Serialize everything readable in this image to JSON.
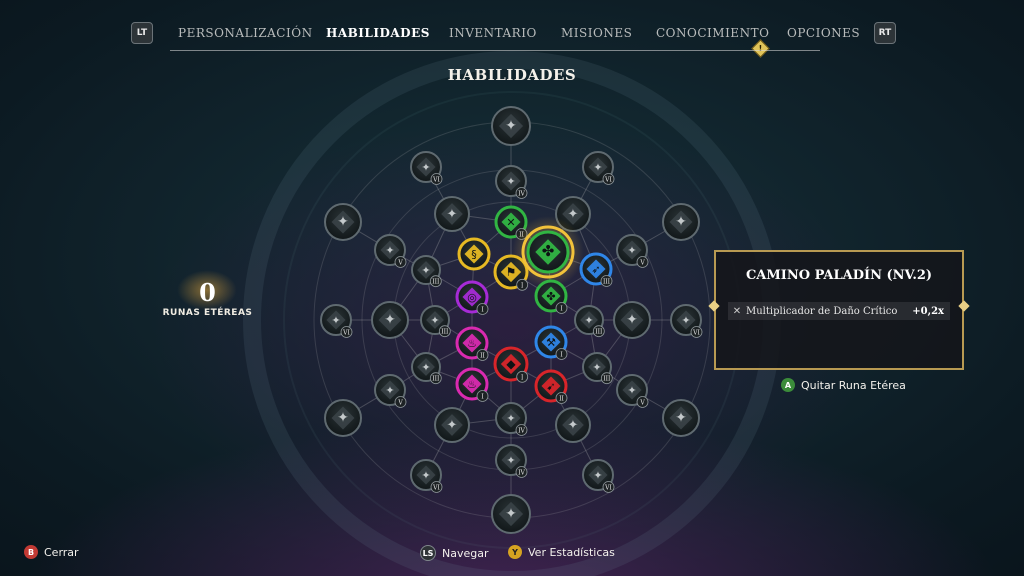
{
  "nav": {
    "left_trigger": "LT",
    "right_trigger": "RT",
    "tabs": [
      {
        "label": "PERSONALIZACIÓN",
        "active": false
      },
      {
        "label": "HABILIDADES",
        "active": true
      },
      {
        "label": "INVENTARIO",
        "active": false
      },
      {
        "label": "MISIONES",
        "active": false
      },
      {
        "label": "CONOCIMIENTO",
        "active": false,
        "badge": "!"
      },
      {
        "label": "OPCIONES",
        "active": false
      }
    ]
  },
  "page_title": "HABILIDADES",
  "runes": {
    "count": "0",
    "label": "RUNAS ETÉREAS"
  },
  "panel": {
    "title": "CAMINO PALADÍN (NV.2)",
    "stat_icon": "crossed-swords-icon",
    "stat_label": "Multiplicador de Daño Crítico",
    "stat_value": "+0,2x",
    "action_button": "A",
    "action_label": "Quitar Runa Etérea"
  },
  "footer": {
    "close_button": "B",
    "close_label": "Cerrar",
    "navigate_button": "LS",
    "navigate_label": "Navegar",
    "stats_button": "Y",
    "stats_label": "Ver Estadísticas"
  },
  "colors": {
    "gold": "#e6b923",
    "green": "#31b543",
    "blue": "#2f86e8",
    "purple": "#a62bd6",
    "magenta": "#d92ab0",
    "red": "#d8252a",
    "node_gray": "#5f6a70"
  },
  "skill_tree": {
    "nodes": [
      {
        "id": "core",
        "color": "gold",
        "icon": "flag-icon",
        "level": "I"
      },
      {
        "id": "inner-n",
        "color": "green",
        "icon": "sword-icon",
        "level": "II"
      },
      {
        "id": "inner-ne",
        "color": "green",
        "icon": "clover-icon",
        "level": "",
        "selected": true
      },
      {
        "id": "inner-e",
        "color": "green",
        "icon": "clover-icon",
        "level": "I"
      },
      {
        "id": "inner-se",
        "color": "blue",
        "icon": "hammer-icon",
        "level": "I"
      },
      {
        "id": "inner-s",
        "color": "red",
        "icon": "diamond-icon",
        "level": "I"
      },
      {
        "id": "inner-sw",
        "color": "magenta",
        "icon": "flame-icon",
        "level": "I"
      },
      {
        "id": "inner-w",
        "color": "purple",
        "icon": "swirl-icon",
        "level": "I"
      },
      {
        "id": "inner-nw",
        "color": "gold",
        "icon": "helix-icon",
        "level": ""
      },
      {
        "id": "ring-ne2",
        "color": "blue",
        "icon": "arrow-icon",
        "level": "III"
      },
      {
        "id": "ring-se2",
        "color": "red",
        "icon": "bow-icon",
        "level": "II"
      },
      {
        "id": "ring-sw2",
        "color": "magenta",
        "icon": "flame-icon",
        "level": "II"
      }
    ]
  }
}
